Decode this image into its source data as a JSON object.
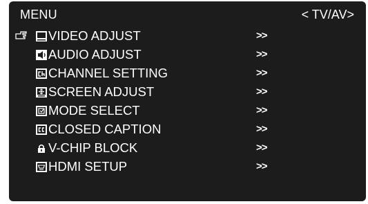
{
  "menu": {
    "title": "MENU",
    "source": "< TV/AV>",
    "selected_index": 0,
    "items": [
      {
        "label": "VIDEO ADJUST",
        "icon": "monitor-icon",
        "arrow": ">>"
      },
      {
        "label": "AUDIO ADJUST",
        "icon": "speaker-icon",
        "arrow": ">>"
      },
      {
        "label": "CHANNEL SETTING",
        "icon": "ch-icon",
        "arrow": ">>"
      },
      {
        "label": "SCREEN ADJUST",
        "icon": "screen-adjust-icon",
        "arrow": ">>"
      },
      {
        "label": "MODE SELECT",
        "icon": "mode-icon",
        "arrow": ">>"
      },
      {
        "label": "CLOSED CAPTION",
        "icon": "cc-icon",
        "arrow": ">>"
      },
      {
        "label": "V-CHIP BLOCK",
        "icon": "lock-icon",
        "arrow": ">>"
      },
      {
        "label": "HDMI SETUP",
        "icon": "hdmi-icon",
        "arrow": ">>"
      }
    ]
  },
  "colors": {
    "background": "#1c1c1c",
    "text": "#ffffff"
  }
}
